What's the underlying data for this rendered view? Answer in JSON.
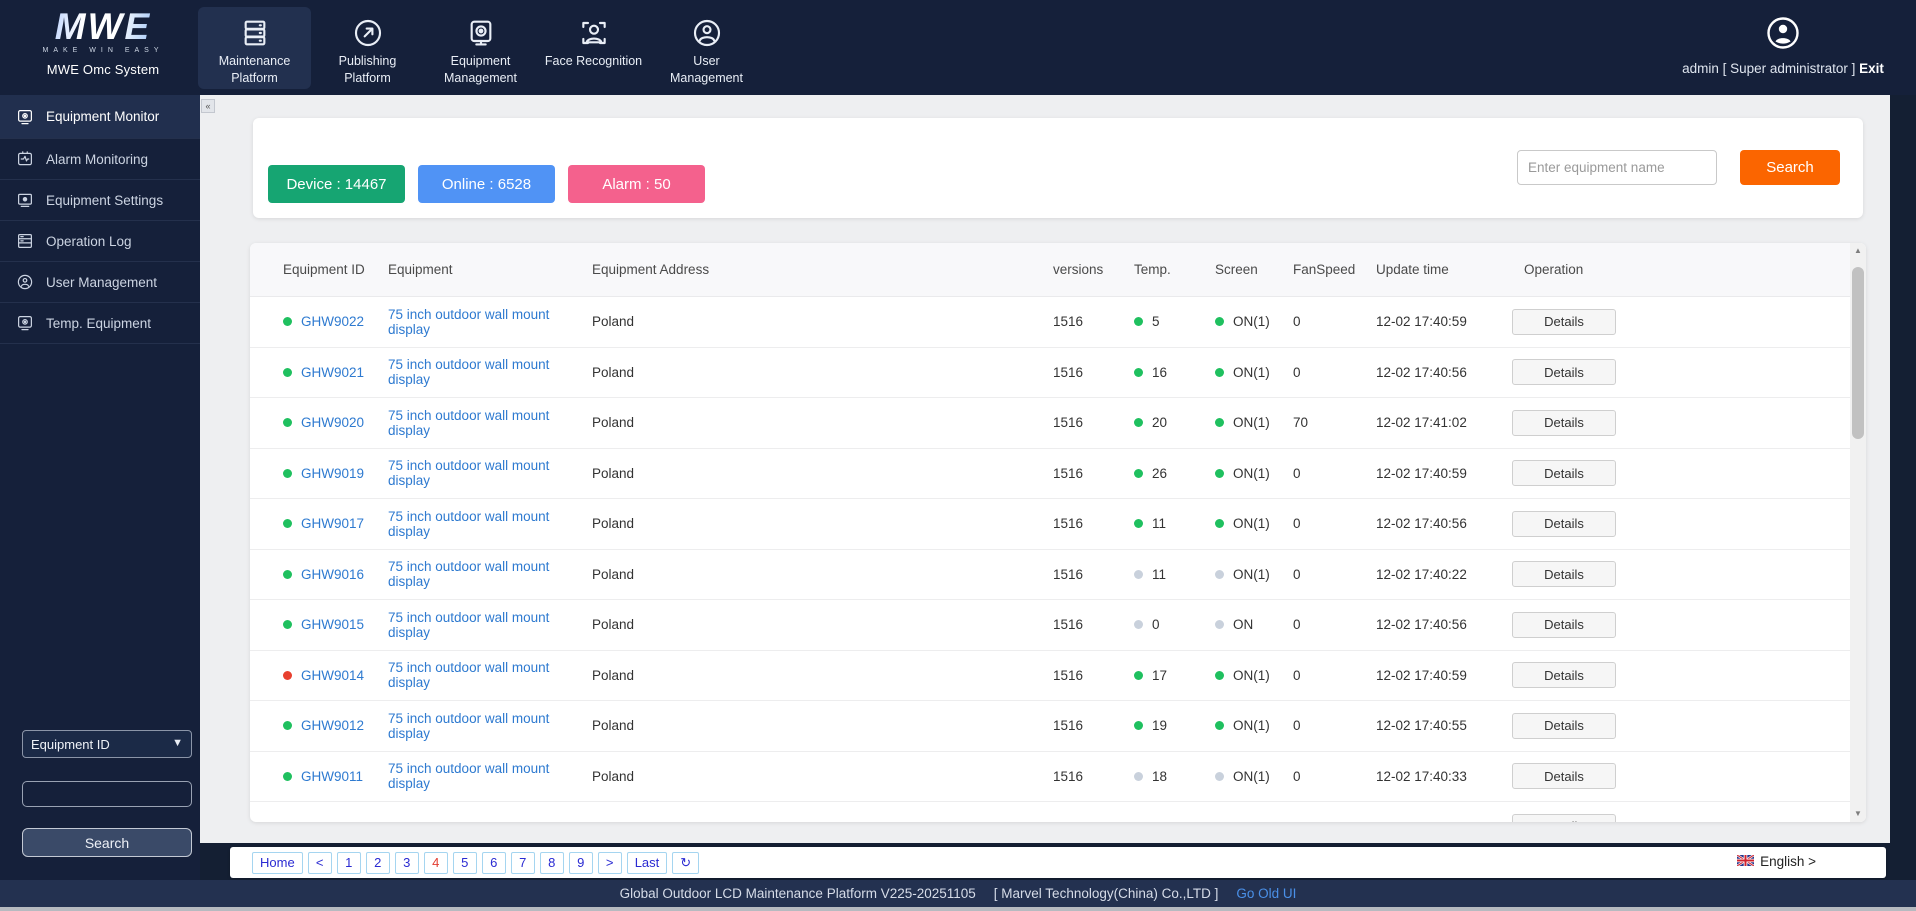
{
  "header": {
    "logo": {
      "brand": "MWE",
      "tagline": "MAKE WIN EASY",
      "system_name": "MWE Omc System"
    },
    "nav": [
      {
        "label": "Maintenance Platform",
        "icon": "server-icon",
        "active": true
      },
      {
        "label": "Publishing Platform",
        "icon": "publish-icon",
        "active": false
      },
      {
        "label": "Equipment Management",
        "icon": "monitor-gear-icon",
        "active": false
      },
      {
        "label": "Face Recognition",
        "icon": "face-scan-icon",
        "active": false
      },
      {
        "label": "User Management",
        "icon": "user-circle-icon",
        "active": false
      }
    ],
    "user": {
      "name_text": "admin [ Super administrator ]",
      "exit_label": "Exit"
    }
  },
  "sidebar": {
    "items": [
      {
        "label": "Equipment Monitor",
        "icon": "monitor-icon",
        "active": true
      },
      {
        "label": "Alarm Monitoring",
        "icon": "alarm-icon",
        "active": false
      },
      {
        "label": "Equipment Settings",
        "icon": "settings-monitor-icon",
        "active": false
      },
      {
        "label": "Operation Log",
        "icon": "log-icon",
        "active": false
      },
      {
        "label": "User Management",
        "icon": "user-icon",
        "active": false
      },
      {
        "label": "Temp. Equipment",
        "icon": "temp-monitor-icon",
        "active": false
      }
    ],
    "filter": {
      "select_value": "Equipment ID",
      "input_value": "",
      "search_label": "Search"
    }
  },
  "stats": [
    {
      "label": "Device : 14467",
      "color": "#16a572"
    },
    {
      "label": "Online : 6528",
      "color": "#5093f5"
    },
    {
      "label": "Alarm : 50",
      "color": "#f4618d"
    }
  ],
  "search": {
    "placeholder": "Enter equipment name",
    "button_label": "Search"
  },
  "table": {
    "columns": [
      "Equipment ID",
      "Equipment",
      "Equipment Address",
      "versions",
      "Temp.",
      "Screen",
      "FanSpeed",
      "Update time",
      "Operation"
    ],
    "details_label": "Details",
    "rows": [
      {
        "id": "GHW9022",
        "id_status": "green",
        "equipment": "75 inch outdoor wall mount display",
        "address": "Poland",
        "version": "1516",
        "temp": "5",
        "temp_status": "green",
        "screen": "ON(1)",
        "screen_status": "green",
        "fan": "0",
        "updated": "12-02 17:40:59"
      },
      {
        "id": "GHW9021",
        "id_status": "green",
        "equipment": "75 inch outdoor wall mount display",
        "address": "Poland",
        "version": "1516",
        "temp": "16",
        "temp_status": "green",
        "screen": "ON(1)",
        "screen_status": "green",
        "fan": "0",
        "updated": "12-02 17:40:56"
      },
      {
        "id": "GHW9020",
        "id_status": "green",
        "equipment": "75 inch outdoor wall mount display",
        "address": "Poland",
        "version": "1516",
        "temp": "20",
        "temp_status": "green",
        "screen": "ON(1)",
        "screen_status": "green",
        "fan": "70",
        "updated": "12-02 17:41:02"
      },
      {
        "id": "GHW9019",
        "id_status": "green",
        "equipment": "75 inch outdoor wall mount display",
        "address": "Poland",
        "version": "1516",
        "temp": "26",
        "temp_status": "green",
        "screen": "ON(1)",
        "screen_status": "green",
        "fan": "0",
        "updated": "12-02 17:40:59"
      },
      {
        "id": "GHW9017",
        "id_status": "green",
        "equipment": "75 inch outdoor wall mount display",
        "address": "Poland",
        "version": "1516",
        "temp": "11",
        "temp_status": "green",
        "screen": "ON(1)",
        "screen_status": "green",
        "fan": "0",
        "updated": "12-02 17:40:56"
      },
      {
        "id": "GHW9016",
        "id_status": "green",
        "equipment": "75 inch outdoor wall mount display",
        "address": "Poland",
        "version": "1516",
        "temp": "11",
        "temp_status": "gray",
        "screen": "ON(1)",
        "screen_status": "gray",
        "fan": "0",
        "updated": "12-02 17:40:22"
      },
      {
        "id": "GHW9015",
        "id_status": "green",
        "equipment": "75 inch outdoor wall mount display",
        "address": "Poland",
        "version": "1516",
        "temp": "0",
        "temp_status": "gray",
        "screen": "ON",
        "screen_status": "gray",
        "fan": "0",
        "updated": "12-02 17:40:56"
      },
      {
        "id": "GHW9014",
        "id_status": "red",
        "equipment": "75 inch outdoor wall mount display",
        "address": "Poland",
        "version": "1516",
        "temp": "17",
        "temp_status": "green",
        "screen": "ON(1)",
        "screen_status": "green",
        "fan": "0",
        "updated": "12-02 17:40:59"
      },
      {
        "id": "GHW9012",
        "id_status": "green",
        "equipment": "75 inch outdoor wall mount display",
        "address": "Poland",
        "version": "1516",
        "temp": "19",
        "temp_status": "green",
        "screen": "ON(1)",
        "screen_status": "green",
        "fan": "0",
        "updated": "12-02 17:40:55"
      },
      {
        "id": "GHW9011",
        "id_status": "green",
        "equipment": "75 inch outdoor wall mount display",
        "address": "Poland",
        "version": "1516",
        "temp": "18",
        "temp_status": "gray",
        "screen": "ON(1)",
        "screen_status": "gray",
        "fan": "0",
        "updated": "12-02 17:40:33"
      }
    ]
  },
  "pagination": {
    "items": [
      {
        "label": "Home"
      },
      {
        "label": "<"
      },
      {
        "label": "1"
      },
      {
        "label": "2"
      },
      {
        "label": "3"
      },
      {
        "label": "4",
        "current": true
      },
      {
        "label": "5"
      },
      {
        "label": "6"
      },
      {
        "label": "7"
      },
      {
        "label": "8"
      },
      {
        "label": "9"
      },
      {
        "label": ">"
      },
      {
        "label": "Last"
      },
      {
        "label": "↻",
        "icon": "refresh-icon"
      }
    ]
  },
  "language": {
    "label": "English >",
    "flag": "uk-flag-icon"
  },
  "footer": {
    "platform_text": "Global Outdoor LCD Maintenance Platform V225-20251105",
    "company_text": "[   Marvel Technology(China) Co.,LTD   ]",
    "link_label": "Go Old UI"
  },
  "colors": {
    "dot_green": "#1fc05f",
    "dot_gray": "#c9d1dc",
    "dot_red": "#e8402f",
    "accent_orange": "#fb6500",
    "link_blue": "#2e7ad0",
    "pagination_blue": "#2a2ad2",
    "current_page_red": "#e23c30"
  }
}
